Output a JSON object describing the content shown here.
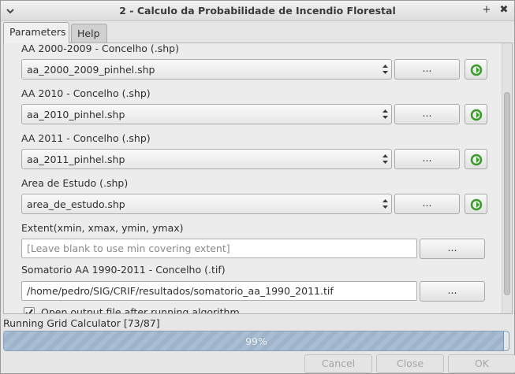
{
  "window": {
    "title": "2 - Calculo da Probabilidade de Incendio Florestal",
    "pin_symbol": "+",
    "close_symbol": "✖"
  },
  "tabs": [
    {
      "label": "Parameters"
    },
    {
      "label": "Help"
    }
  ],
  "params": {
    "p0": {
      "label": "AA 2000-2009 - Concelho (.shp)",
      "value": "aa_2000_2009_pinhel.shp",
      "browse": "..."
    },
    "p1": {
      "label": "AA 2010 - Concelho (.shp)",
      "value": "aa_2010_pinhel.shp",
      "browse": "..."
    },
    "p2": {
      "label": "AA 2011 - Concelho (.shp)",
      "value": "aa_2011_pinhel.shp",
      "browse": "..."
    },
    "p3": {
      "label": "Area de Estudo (.shp)",
      "value": "area_de_estudo.shp",
      "browse": "..."
    },
    "extent": {
      "label": "Extent(xmin, xmax, ymin, ymax)",
      "value": "",
      "placeholder": "[Leave blank to use min covering extent]",
      "browse": "..."
    },
    "output": {
      "label": "Somatorio AA 1990-2011 - Concelho (.tif)",
      "value": "/home/pedro/SIG/CRIF/resultados/somatorio_aa_1990_2011.tif",
      "browse": "..."
    },
    "open_output": {
      "label": "Open output file after running algorithm",
      "checked": true
    }
  },
  "status": {
    "text": "Running Grid Calculator [73/87]",
    "progress_percent": 99,
    "progress_label": "99%"
  },
  "buttons": {
    "cancel": "Cancel",
    "close": "Close",
    "ok": "OK"
  },
  "colors": {
    "iterate_icon": "#3a9a2a",
    "progress_fill": "#a9bdd3"
  }
}
